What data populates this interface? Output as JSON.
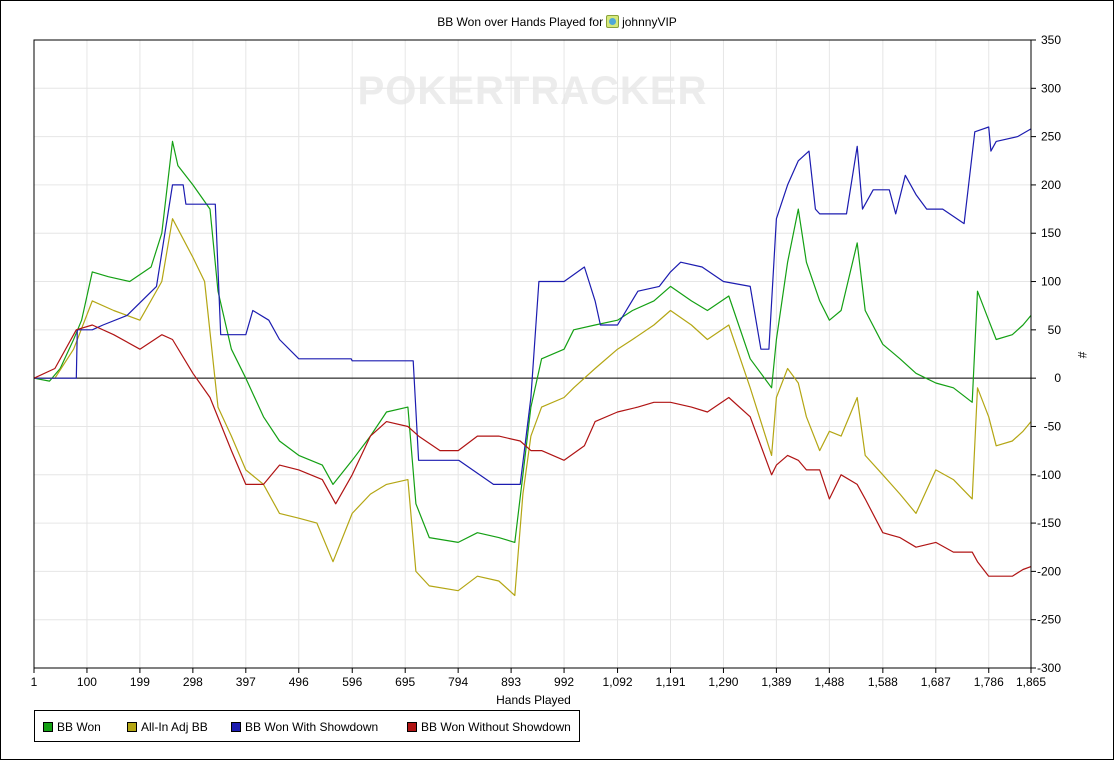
{
  "title_prefix": "BB Won over Hands Played for",
  "player_name": "johnnyVIP",
  "watermark": "POKERTRACKER",
  "icons": {
    "player": "player-avatar-icon"
  },
  "colors": {
    "bb_won": "#14a014",
    "allin_adj": "#b4a614",
    "showdown": "#1c1cb0",
    "no_showdown": "#b01414",
    "grid": "#e6e6e6"
  },
  "chart_data": {
    "type": "line",
    "title": "BB Won over Hands Played for johnnyVIP",
    "xlabel": "Hands Played",
    "ylabel": "#",
    "xlim": [
      1,
      1865
    ],
    "ylim": [
      -300,
      350
    ],
    "x_ticks": [
      "1",
      "100",
      "199",
      "298",
      "397",
      "496",
      "596",
      "695",
      "794",
      "893",
      "992",
      "1,092",
      "1,191",
      "1,290",
      "1,389",
      "1,488",
      "1,588",
      "1,687",
      "1,786",
      "1,865"
    ],
    "y_ticks": [
      350,
      300,
      250,
      200,
      150,
      100,
      50,
      0,
      -50,
      -100,
      -150,
      -200,
      -250,
      -300
    ],
    "grid": true,
    "legend_position": "bottom-left",
    "series": [
      {
        "name": "BB Won",
        "color": "#14a014",
        "points": [
          [
            1,
            0
          ],
          [
            30,
            -3
          ],
          [
            50,
            10
          ],
          [
            75,
            40
          ],
          [
            90,
            60
          ],
          [
            110,
            110
          ],
          [
            140,
            105
          ],
          [
            180,
            100
          ],
          [
            220,
            115
          ],
          [
            240,
            150
          ],
          [
            260,
            245
          ],
          [
            270,
            220
          ],
          [
            298,
            200
          ],
          [
            330,
            175
          ],
          [
            345,
            90
          ],
          [
            370,
            30
          ],
          [
            397,
            0
          ],
          [
            430,
            -40
          ],
          [
            460,
            -65
          ],
          [
            496,
            -80
          ],
          [
            540,
            -90
          ],
          [
            560,
            -110
          ],
          [
            596,
            -85
          ],
          [
            630,
            -60
          ],
          [
            660,
            -35
          ],
          [
            700,
            -30
          ],
          [
            715,
            -130
          ],
          [
            740,
            -165
          ],
          [
            794,
            -170
          ],
          [
            830,
            -160
          ],
          [
            870,
            -165
          ],
          [
            900,
            -170
          ],
          [
            915,
            -100
          ],
          [
            930,
            -30
          ],
          [
            950,
            20
          ],
          [
            992,
            30
          ],
          [
            1010,
            50
          ],
          [
            1050,
            55
          ],
          [
            1092,
            60
          ],
          [
            1120,
            70
          ],
          [
            1160,
            80
          ],
          [
            1191,
            95
          ],
          [
            1230,
            80
          ],
          [
            1260,
            70
          ],
          [
            1300,
            85
          ],
          [
            1340,
            20
          ],
          [
            1380,
            -10
          ],
          [
            1389,
            40
          ],
          [
            1410,
            120
          ],
          [
            1430,
            175
          ],
          [
            1445,
            120
          ],
          [
            1470,
            80
          ],
          [
            1488,
            60
          ],
          [
            1510,
            70
          ],
          [
            1540,
            140
          ],
          [
            1555,
            70
          ],
          [
            1588,
            35
          ],
          [
            1620,
            20
          ],
          [
            1650,
            5
          ],
          [
            1687,
            -5
          ],
          [
            1720,
            -10
          ],
          [
            1755,
            -25
          ],
          [
            1765,
            90
          ],
          [
            1786,
            60
          ],
          [
            1800,
            40
          ],
          [
            1830,
            45
          ],
          [
            1850,
            55
          ],
          [
            1865,
            65
          ]
        ]
      },
      {
        "name": "All-In Adj BB",
        "color": "#b4a614",
        "points": [
          [
            1,
            0
          ],
          [
            40,
            0
          ],
          [
            75,
            30
          ],
          [
            110,
            80
          ],
          [
            150,
            70
          ],
          [
            199,
            60
          ],
          [
            240,
            100
          ],
          [
            260,
            165
          ],
          [
            298,
            125
          ],
          [
            320,
            100
          ],
          [
            345,
            -30
          ],
          [
            370,
            -60
          ],
          [
            397,
            -95
          ],
          [
            430,
            -110
          ],
          [
            460,
            -140
          ],
          [
            496,
            -145
          ],
          [
            530,
            -150
          ],
          [
            560,
            -190
          ],
          [
            596,
            -140
          ],
          [
            630,
            -120
          ],
          [
            660,
            -110
          ],
          [
            700,
            -105
          ],
          [
            715,
            -200
          ],
          [
            740,
            -215
          ],
          [
            794,
            -220
          ],
          [
            830,
            -205
          ],
          [
            870,
            -210
          ],
          [
            900,
            -225
          ],
          [
            915,
            -120
          ],
          [
            930,
            -60
          ],
          [
            950,
            -30
          ],
          [
            992,
            -20
          ],
          [
            1010,
            -10
          ],
          [
            1050,
            10
          ],
          [
            1092,
            30
          ],
          [
            1120,
            40
          ],
          [
            1160,
            55
          ],
          [
            1191,
            70
          ],
          [
            1230,
            55
          ],
          [
            1260,
            40
          ],
          [
            1300,
            55
          ],
          [
            1340,
            -10
          ],
          [
            1380,
            -80
          ],
          [
            1389,
            -20
          ],
          [
            1410,
            10
          ],
          [
            1430,
            -5
          ],
          [
            1445,
            -40
          ],
          [
            1470,
            -75
          ],
          [
            1488,
            -55
          ],
          [
            1510,
            -60
          ],
          [
            1540,
            -20
          ],
          [
            1555,
            -80
          ],
          [
            1588,
            -100
          ],
          [
            1620,
            -120
          ],
          [
            1650,
            -140
          ],
          [
            1687,
            -95
          ],
          [
            1720,
            -105
          ],
          [
            1755,
            -125
          ],
          [
            1765,
            -10
          ],
          [
            1786,
            -40
          ],
          [
            1800,
            -70
          ],
          [
            1830,
            -65
          ],
          [
            1850,
            -55
          ],
          [
            1865,
            -45
          ]
        ]
      },
      {
        "name": "BB Won With Showdown",
        "color": "#1c1cb0",
        "points": [
          [
            1,
            0
          ],
          [
            80,
            0
          ],
          [
            82,
            50
          ],
          [
            110,
            50
          ],
          [
            130,
            55
          ],
          [
            175,
            65
          ],
          [
            230,
            95
          ],
          [
            260,
            200
          ],
          [
            280,
            200
          ],
          [
            285,
            180
          ],
          [
            340,
            180
          ],
          [
            350,
            45
          ],
          [
            397,
            45
          ],
          [
            410,
            70
          ],
          [
            440,
            60
          ],
          [
            460,
            40
          ],
          [
            496,
            20
          ],
          [
            594,
            20
          ],
          [
            596,
            18
          ],
          [
            710,
            18
          ],
          [
            720,
            -85
          ],
          [
            795,
            -85
          ],
          [
            860,
            -110
          ],
          [
            910,
            -110
          ],
          [
            930,
            -20
          ],
          [
            945,
            100
          ],
          [
            980,
            100
          ],
          [
            992,
            100
          ],
          [
            1030,
            115
          ],
          [
            1050,
            80
          ],
          [
            1060,
            55
          ],
          [
            1092,
            55
          ],
          [
            1130,
            90
          ],
          [
            1170,
            95
          ],
          [
            1191,
            110
          ],
          [
            1210,
            120
          ],
          [
            1250,
            115
          ],
          [
            1290,
            100
          ],
          [
            1340,
            95
          ],
          [
            1360,
            30
          ],
          [
            1375,
            30
          ],
          [
            1389,
            165
          ],
          [
            1410,
            200
          ],
          [
            1430,
            225
          ],
          [
            1450,
            235
          ],
          [
            1462,
            175
          ],
          [
            1470,
            170
          ],
          [
            1520,
            170
          ],
          [
            1540,
            240
          ],
          [
            1550,
            175
          ],
          [
            1570,
            195
          ],
          [
            1600,
            195
          ],
          [
            1612,
            170
          ],
          [
            1630,
            210
          ],
          [
            1650,
            190
          ],
          [
            1670,
            175
          ],
          [
            1700,
            175
          ],
          [
            1740,
            160
          ],
          [
            1760,
            255
          ],
          [
            1786,
            260
          ],
          [
            1790,
            235
          ],
          [
            1800,
            245
          ],
          [
            1840,
            250
          ],
          [
            1865,
            258
          ]
        ]
      },
      {
        "name": "BB Won Without Showdown",
        "color": "#b01414",
        "points": [
          [
            1,
            0
          ],
          [
            40,
            10
          ],
          [
            80,
            50
          ],
          [
            110,
            55
          ],
          [
            150,
            45
          ],
          [
            199,
            30
          ],
          [
            240,
            45
          ],
          [
            260,
            40
          ],
          [
            298,
            5
          ],
          [
            330,
            -20
          ],
          [
            370,
            -75
          ],
          [
            397,
            -110
          ],
          [
            430,
            -110
          ],
          [
            460,
            -90
          ],
          [
            496,
            -95
          ],
          [
            540,
            -105
          ],
          [
            565,
            -130
          ],
          [
            596,
            -100
          ],
          [
            630,
            -60
          ],
          [
            660,
            -45
          ],
          [
            700,
            -50
          ],
          [
            720,
            -60
          ],
          [
            760,
            -75
          ],
          [
            794,
            -75
          ],
          [
            830,
            -60
          ],
          [
            870,
            -60
          ],
          [
            910,
            -65
          ],
          [
            930,
            -75
          ],
          [
            950,
            -75
          ],
          [
            992,
            -85
          ],
          [
            1030,
            -70
          ],
          [
            1050,
            -45
          ],
          [
            1092,
            -35
          ],
          [
            1130,
            -30
          ],
          [
            1160,
            -25
          ],
          [
            1191,
            -25
          ],
          [
            1230,
            -30
          ],
          [
            1260,
            -35
          ],
          [
            1300,
            -20
          ],
          [
            1340,
            -40
          ],
          [
            1380,
            -100
          ],
          [
            1389,
            -90
          ],
          [
            1410,
            -80
          ],
          [
            1430,
            -85
          ],
          [
            1445,
            -95
          ],
          [
            1470,
            -95
          ],
          [
            1488,
            -125
          ],
          [
            1510,
            -100
          ],
          [
            1540,
            -110
          ],
          [
            1555,
            -125
          ],
          [
            1588,
            -160
          ],
          [
            1620,
            -165
          ],
          [
            1650,
            -175
          ],
          [
            1687,
            -170
          ],
          [
            1720,
            -180
          ],
          [
            1755,
            -180
          ],
          [
            1765,
            -190
          ],
          [
            1786,
            -205
          ],
          [
            1800,
            -205
          ],
          [
            1830,
            -205
          ],
          [
            1850,
            -198
          ],
          [
            1865,
            -195
          ]
        ]
      }
    ]
  }
}
